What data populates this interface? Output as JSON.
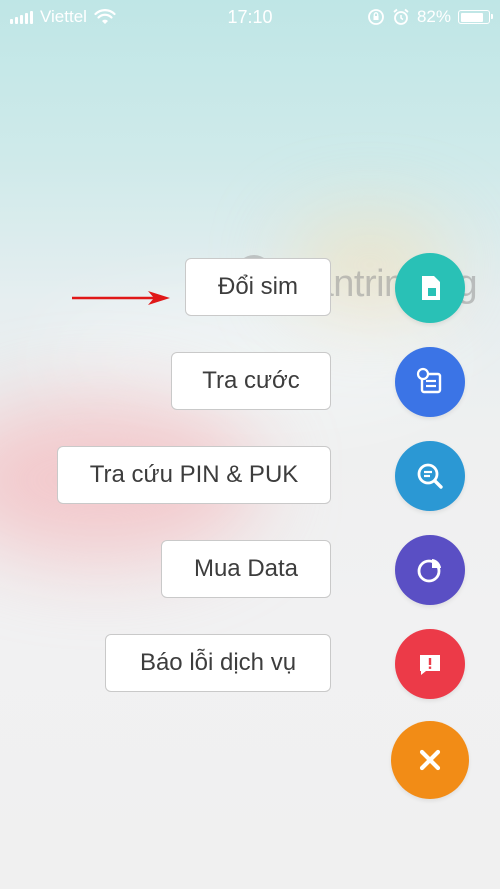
{
  "status_bar": {
    "carrier": "Viettel",
    "time": "17:10",
    "battery_percent": "82%",
    "battery_level": 0.82
  },
  "watermark": {
    "text": "uantrimang"
  },
  "menu": {
    "items": [
      {
        "label": "Đổi sim",
        "icon": "sim-card-icon",
        "color": "#29c1b6"
      },
      {
        "label": "Tra cước",
        "icon": "billing-list-icon",
        "color": "#3b74e6"
      },
      {
        "label": "Tra cứu PIN & PUK",
        "icon": "search-icon",
        "color": "#2b98d4"
      },
      {
        "label": "Mua Data",
        "icon": "pie-chart-icon",
        "color": "#5a4fc4"
      },
      {
        "label": "Báo lỗi dịch vụ",
        "icon": "report-message-icon",
        "color": "#ec3a48"
      }
    ],
    "close": {
      "icon": "close-icon",
      "color": "#f28c16"
    }
  },
  "annotation": {
    "color": "#e01818"
  }
}
